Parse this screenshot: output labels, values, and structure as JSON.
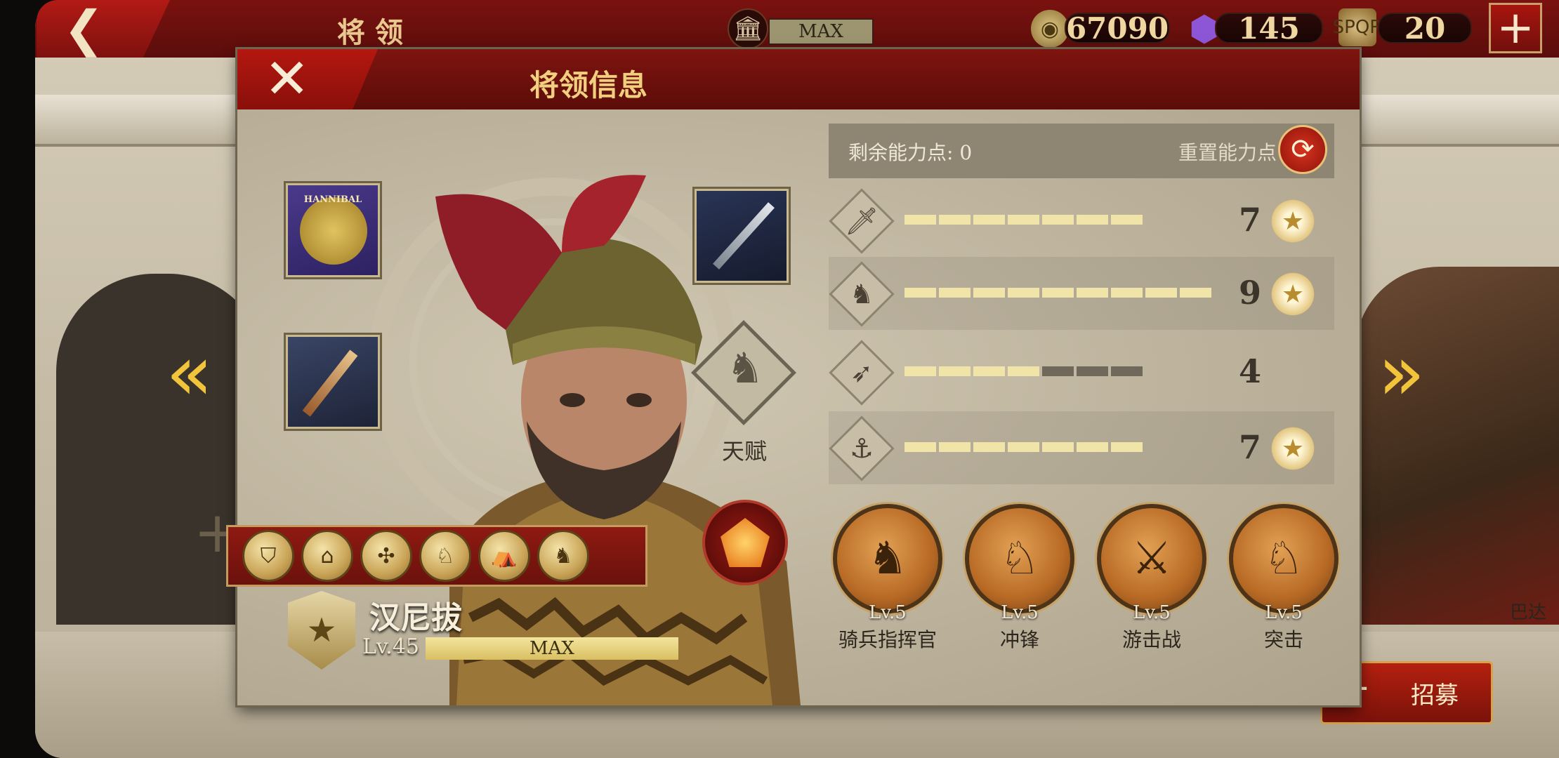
{
  "topbar": {
    "back_icon": "back-arrow-icon",
    "title": "将领",
    "building_status": "MAX",
    "gold": "67090",
    "gems": "145",
    "tokens": "20",
    "add_icon": "plus-icon"
  },
  "panel": {
    "title": "将领信息",
    "close_icon": "close-icon"
  },
  "equipment": {
    "banner_text": "HANNIBAL",
    "slots": [
      "banner-icon",
      "spear-icon",
      "sword-icon"
    ]
  },
  "talent": {
    "label": "天赋",
    "icon": "horse-skull-icon"
  },
  "skills_strip": [
    "shield-skill-icon",
    "gate-skill-icon",
    "wheel-skill-icon",
    "rider-skill-icon",
    "camp-skill-icon",
    "horse-skill-icon"
  ],
  "hero": {
    "name": "汉尼拔",
    "level": "Lv.45",
    "xp_label": "MAX",
    "rank_icon": "star-laurel-icon"
  },
  "stats": {
    "remaining_label": "剩余能力点: 0",
    "reset_label": "重置能力点",
    "rows": [
      {
        "icon": "sword-icon",
        "value": "7",
        "filled": 7,
        "max": 7,
        "badge": true
      },
      {
        "icon": "horse-head-icon",
        "value": "9",
        "filled": 9,
        "max": 9,
        "badge": true
      },
      {
        "icon": "bow-icon",
        "value": "4",
        "filled": 4,
        "max": 7,
        "badge": false
      },
      {
        "icon": "anchor-icon",
        "value": "7",
        "filled": 7,
        "max": 7,
        "badge": true
      }
    ]
  },
  "abilities": [
    {
      "level": "Lv.5",
      "name": "骑兵指挥官",
      "icon": "horse-icon"
    },
    {
      "level": "Lv.5",
      "name": "冲锋",
      "icon": "charging-rider-icon"
    },
    {
      "level": "Lv.5",
      "name": "游击战",
      "icon": "skirmishers-icon"
    },
    {
      "level": "Lv.5",
      "name": "突击",
      "icon": "assault-rider-icon"
    }
  ],
  "recruit": {
    "label": "招募"
  },
  "side_hero_name": "巴达",
  "colors": {
    "accent_red": "#7a120f",
    "gold": "#f0cf7e",
    "pip_on": "#f1e4a9",
    "pip_off": "#6f685b"
  }
}
